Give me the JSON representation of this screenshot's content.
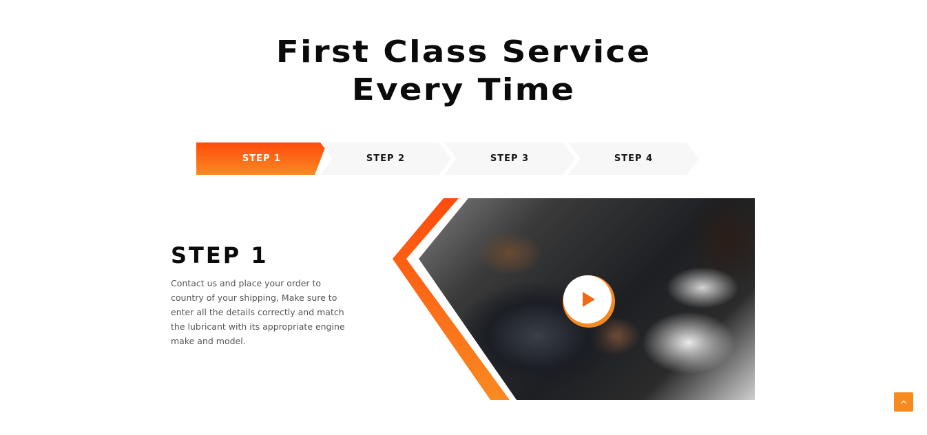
{
  "section": {
    "headline_line1": "First Class Service",
    "headline_line2": "Every Time"
  },
  "steps": {
    "tabs": [
      {
        "label": "STEP 1",
        "active": true
      },
      {
        "label": "STEP 2",
        "active": false
      },
      {
        "label": "STEP 3",
        "active": false
      },
      {
        "label": "STEP 4",
        "active": false
      }
    ]
  },
  "content": {
    "title": "STEP 1",
    "description": "Contact us and place your order to country of your shipping, Make sure to enter all the details correctly and match the lubricant with its appropriate engine make and model."
  },
  "media": {
    "play_icon": "play-icon"
  },
  "scroll_top": {
    "icon": "chevron-up-icon"
  },
  "colors": {
    "accent_start": "#ff4b0c",
    "accent_end": "#f98a22",
    "tab_inactive_bg": "#f7f7f7",
    "heading": "#0b0b0b",
    "body_text": "#555555"
  }
}
